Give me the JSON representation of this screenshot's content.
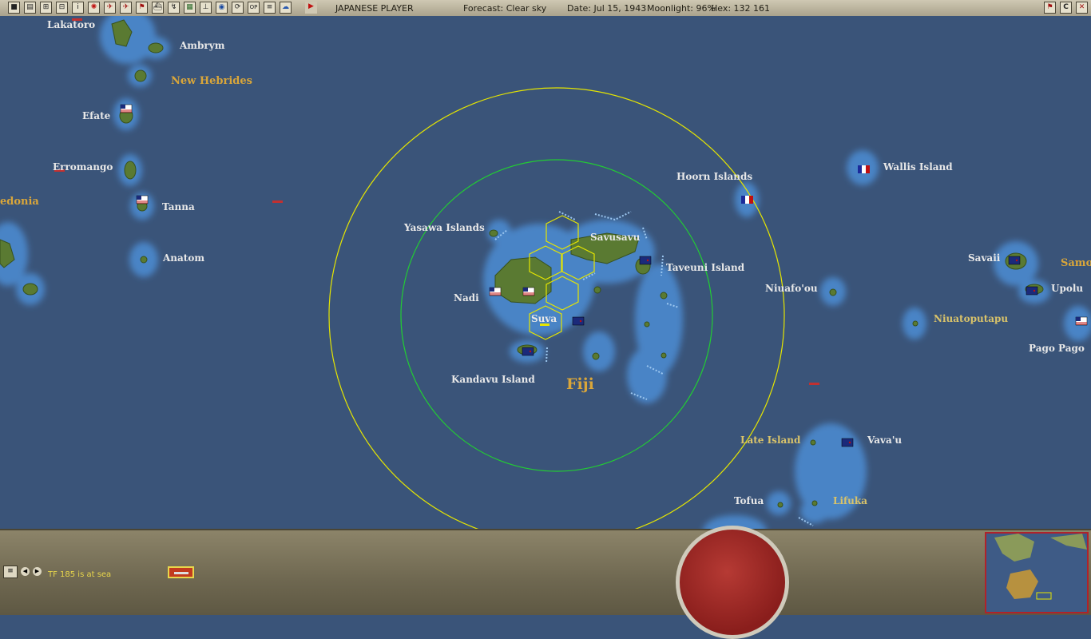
{
  "header": {
    "player": "JAPANESE PLAYER",
    "forecast": "Forecast: Clear sky",
    "date": "Date: Jul 15, 1943",
    "moonlight": "Moonlight: 96%",
    "hex": "Hex: 132 161",
    "toolbar_icons": [
      "end-turn-icon",
      "report-icon",
      "base-list-icon",
      "tf-list-icon",
      "info-icon",
      "japanese-flag-icon",
      "air-unit-icon",
      "aircraft-icon",
      "flag-icon",
      "ship-icon",
      "chart-icon",
      "map-icon",
      "ground-unit-icon",
      "globe-icon",
      "refresh-icon",
      "op-icon",
      "list-icon",
      "weather-icon",
      "play-icon"
    ],
    "op_label": "OP",
    "right_icons": [
      "flag-icon",
      "c-icon",
      "close-icon"
    ],
    "c_label": "C"
  },
  "map": {
    "labels": {
      "lakatoro": "Lakatoro",
      "ambrym": "Ambrym",
      "new_hebrides": "New Hebrides",
      "efate": "Efate",
      "erromango": "Erromango",
      "caledonia": "edonia",
      "tanna": "Tanna",
      "anatom": "Anatom",
      "yasawa": "Yasawa Islands",
      "savusavu": "Savusavu",
      "taveuni": "Taveuni Island",
      "nadi": "Nadi",
      "suva": "Suva",
      "kandavu": "Kandavu Island",
      "fiji": "Fiji",
      "hoorn": "Hoorn Islands",
      "wallis": "Wallis Island",
      "niuafoou": "Niuafo'ou",
      "savaii": "Savaii",
      "samoa": "Samo",
      "upolu": "Upolu",
      "niuatoputapu": "Niuatoputapu",
      "pago": "Pago Pago",
      "late": "Late Island",
      "vavau": "Vava'u",
      "tofua": "Tofua",
      "lifuka": "Lifuka"
    },
    "colors": {
      "ocean": "#3a5479",
      "shallow": "#4a84c6",
      "land": "#5a7a32",
      "outer_ring": "#e6e600",
      "inner_ring": "#22cc33"
    }
  },
  "bottom": {
    "status_text": "TF 185 is at sea",
    "icons": [
      "ship-list-icon",
      "prev-arrow-icon",
      "next-arrow-icon",
      "task-force-icon"
    ]
  }
}
